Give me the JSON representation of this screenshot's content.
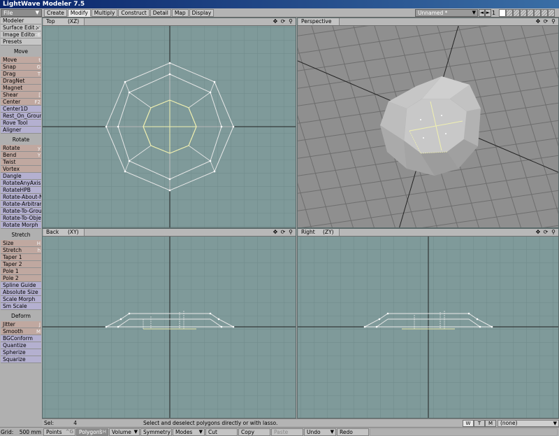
{
  "window": {
    "title": "LightWave Modeler 7.5"
  },
  "menu": {
    "file_label": "File"
  },
  "tabs": [
    "Create",
    "Modify",
    "Multiply",
    "Construct",
    "Detail",
    "Map",
    "Display"
  ],
  "active_tab": "Modify",
  "object_select": {
    "value": "Unnamed *"
  },
  "layer": {
    "number": "1"
  },
  "sidebar": {
    "top": [
      {
        "label": "Modeler",
        "key": ""
      },
      {
        "label": "Surface Editor",
        "key": "F5"
      },
      {
        "label": "Image Editor",
        "key": "F6"
      },
      {
        "label": "Presets",
        "key": ""
      }
    ],
    "move": {
      "header": "Move",
      "items": [
        {
          "label": "Move",
          "key": "t"
        },
        {
          "label": "Snap",
          "key": "G"
        },
        {
          "label": "Drag",
          "key": "T"
        },
        {
          "label": "DragNet",
          "key": ""
        },
        {
          "label": "Magnet",
          "key": ""
        },
        {
          "label": "Shear",
          "key": "["
        },
        {
          "label": "Center",
          "key": "F2"
        },
        {
          "label": "Center1D",
          "key": ""
        },
        {
          "label": "Rest_On_Ground",
          "key": ""
        },
        {
          "label": "Rove Tool",
          "key": ""
        },
        {
          "label": "Aligner",
          "key": ""
        }
      ]
    },
    "rotate": {
      "header": "Rotate",
      "items": [
        {
          "label": "Rotate",
          "key": "y"
        },
        {
          "label": "Bend",
          "key": "Y"
        },
        {
          "label": "Twist",
          "key": ""
        },
        {
          "label": "Vortex",
          "key": ""
        },
        {
          "label": "Dangle",
          "key": ""
        },
        {
          "label": "RotateAnyAxis",
          "key": ""
        },
        {
          "label": "RotateHPB",
          "key": ""
        },
        {
          "label": "Rotate-About-No...",
          "key": ""
        },
        {
          "label": "Rotate-Arbitrary-...",
          "key": ""
        },
        {
          "label": "Rotate-To-Ground",
          "key": ""
        },
        {
          "label": "Rotate-To-Object",
          "key": ""
        },
        {
          "label": "Rotate Morph",
          "key": ""
        }
      ]
    },
    "stretch": {
      "header": "Stretch",
      "items": [
        {
          "label": "Size",
          "key": "H"
        },
        {
          "label": "Stretch",
          "key": "h"
        },
        {
          "label": "Taper 1",
          "key": ""
        },
        {
          "label": "Taper 2",
          "key": ""
        },
        {
          "label": "Pole 1",
          "key": ""
        },
        {
          "label": "Pole 2",
          "key": ""
        },
        {
          "label": "Spline Guide",
          "key": ""
        },
        {
          "label": "Absolute Size",
          "key": ""
        },
        {
          "label": "Scale Morph",
          "key": ""
        },
        {
          "label": "Sm Scale",
          "key": ""
        }
      ]
    },
    "deform": {
      "header": "Deform",
      "items": [
        {
          "label": "Jitter",
          "key": "J"
        },
        {
          "label": "Smooth",
          "key": "M"
        },
        {
          "label": "BGConform",
          "key": ""
        },
        {
          "label": "Quantize",
          "key": ""
        },
        {
          "label": "Spherize",
          "key": ""
        },
        {
          "label": "Squarize",
          "key": ""
        }
      ]
    }
  },
  "viewports": {
    "top": {
      "name": "Top",
      "axis": "(XZ)"
    },
    "perspective": {
      "name": "Perspective"
    },
    "back": {
      "name": "Back",
      "axis": "(XY)"
    },
    "right": {
      "name": "Right",
      "axis": "(ZY)"
    }
  },
  "status": {
    "sel_label": "Sel:",
    "sel_count": "4",
    "message": "Select and deselect polygons directly or with lasso.",
    "w": "W",
    "t": "T",
    "m": "M",
    "surface": "(none)"
  },
  "bottom": {
    "grid_label": "Grid:",
    "grid_value": "500 mm",
    "points": "Points",
    "points_key": "^G",
    "polygons": "Polygons",
    "polygons_key": "^H",
    "volume": "Volume",
    "symmetry": "Symmetry",
    "modes": "Modes",
    "cut": "Cut",
    "copy": "Copy",
    "paste": "Paste",
    "undo": "Undo",
    "redo": "Redo"
  },
  "colors": {
    "viewport_bg": "#7f9a9a",
    "wire": "#e8e8e8",
    "selected": "#f0f0b0"
  }
}
